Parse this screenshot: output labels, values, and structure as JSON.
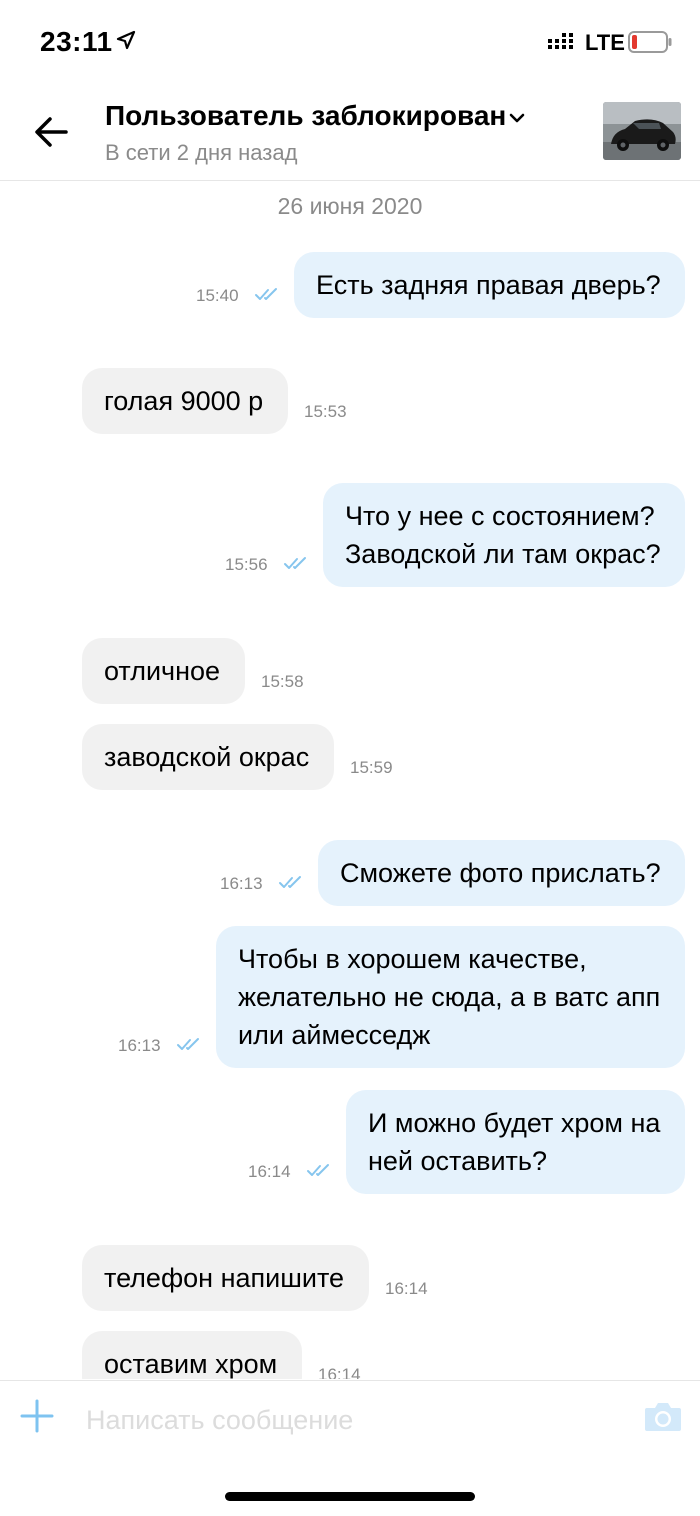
{
  "status_bar": {
    "time": "23:11",
    "network": "LTE",
    "battery_color": "#e3392f"
  },
  "header": {
    "title": "Пользователь заблокирован",
    "subtitle": "В сети 2 дня назад",
    "avatar": "car-photo-thumbnail"
  },
  "chat": {
    "date": "26 июня 2020",
    "messages": [
      {
        "direction": "out",
        "lines": [
          "Есть задняя правая дверь?"
        ],
        "time": "15:40",
        "read": true
      },
      {
        "direction": "in",
        "lines": [
          "голая 9000 р"
        ],
        "time": "15:53"
      },
      {
        "direction": "out",
        "lines": [
          "Что у нее с состоянием?",
          "Заводской ли там окрас?"
        ],
        "time": "15:56",
        "read": true
      },
      {
        "direction": "in",
        "lines": [
          "отличное"
        ],
        "time": "15:58"
      },
      {
        "direction": "in",
        "lines": [
          "заводской окрас"
        ],
        "time": "15:59"
      },
      {
        "direction": "out",
        "lines": [
          "Сможете фото прислать?"
        ],
        "time": "16:13",
        "read": true
      },
      {
        "direction": "out",
        "lines": [
          "Чтобы в хорошем качестве,",
          "желательно не сюда, а в ватс апп",
          "или аймесседж"
        ],
        "time": "16:13",
        "read": true
      },
      {
        "direction": "out",
        "lines": [
          "И можно будет хром на",
          "ней оставить?"
        ],
        "time": "16:14",
        "read": true
      },
      {
        "direction": "in",
        "lines": [
          "телефон напишите"
        ],
        "time": "16:14"
      },
      {
        "direction": "in",
        "lines": [
          "оставим хром"
        ],
        "time": "16:14"
      }
    ]
  },
  "input": {
    "placeholder": "Написать сообщение"
  },
  "colors": {
    "outgoing_bubble": "#e5f2fc",
    "incoming_bubble": "#f1f1f1",
    "accent": "#7ec3f0"
  }
}
